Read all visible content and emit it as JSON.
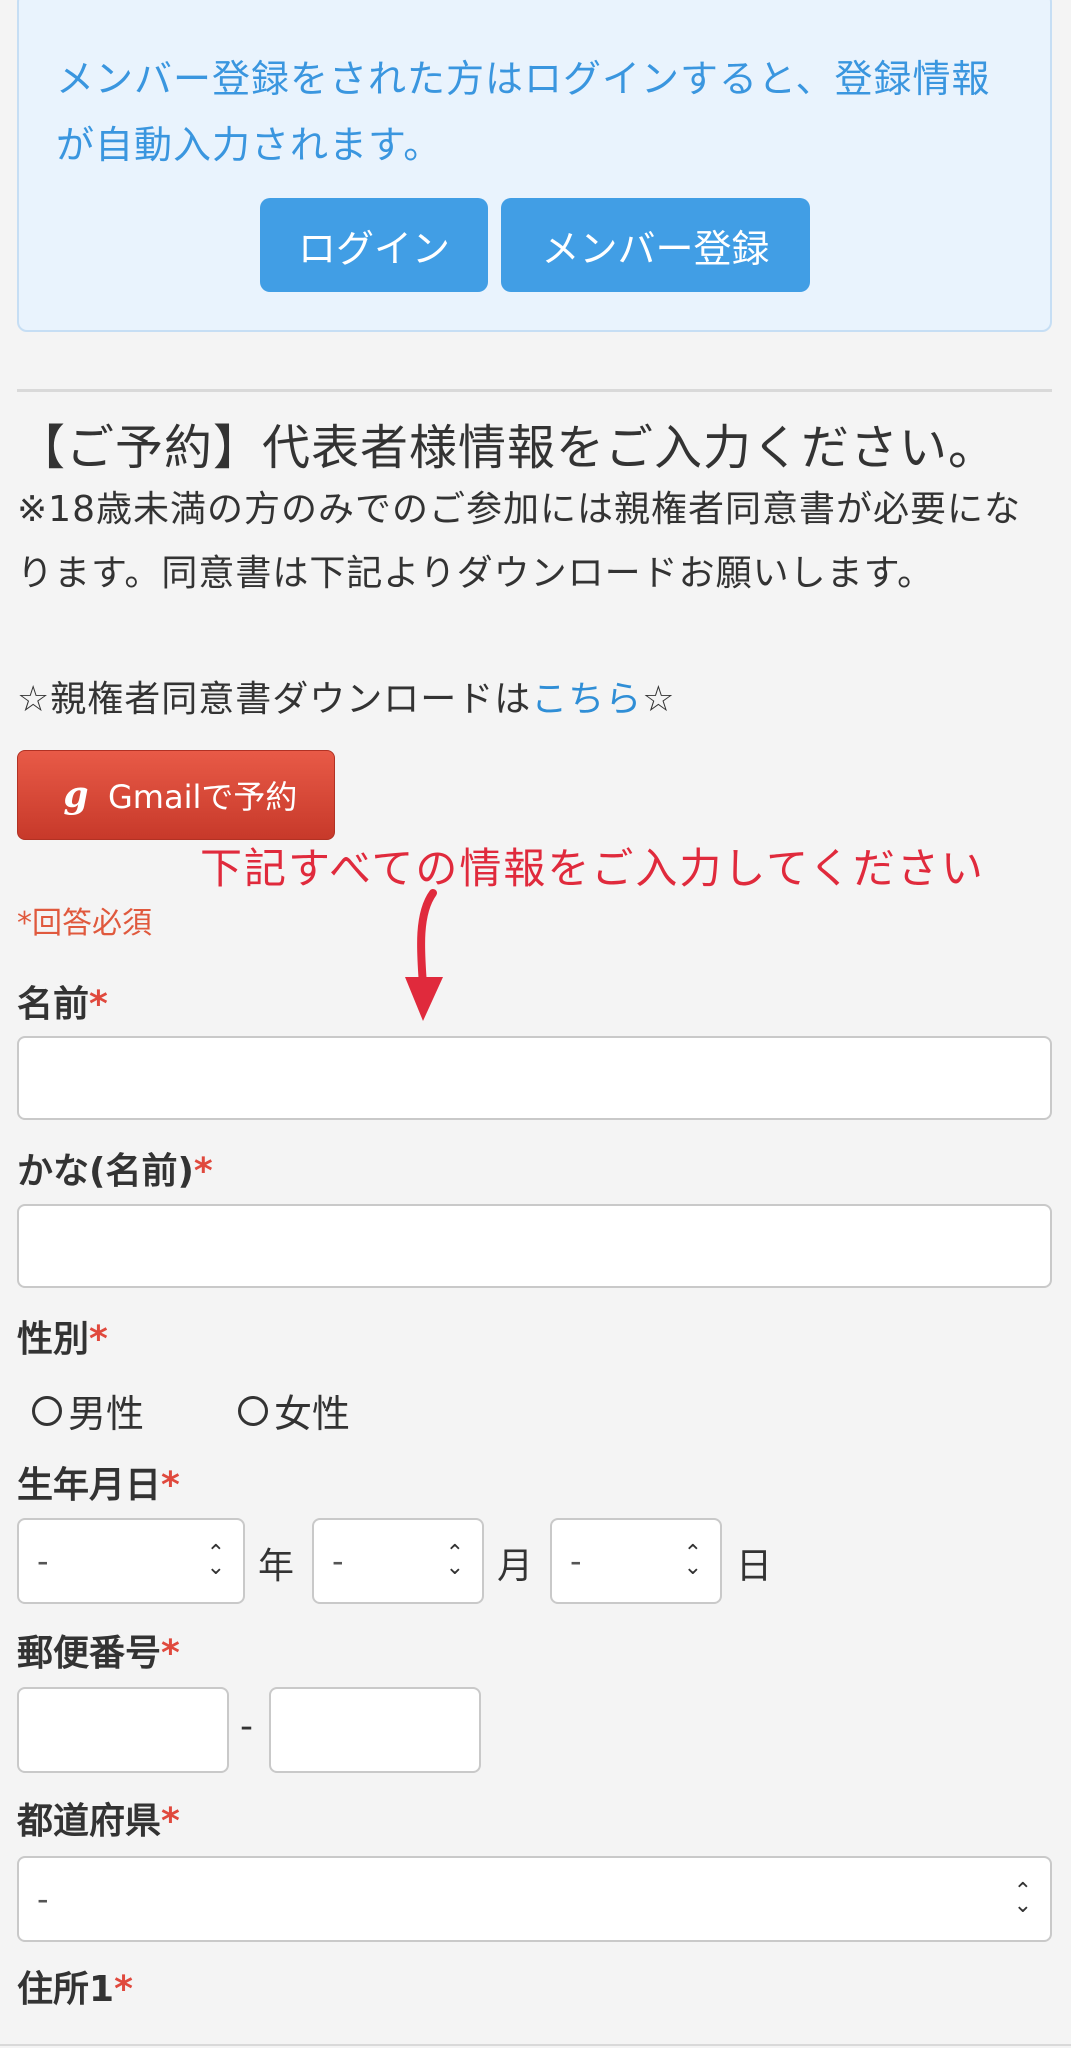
{
  "member_box": {
    "text": "メンバー登録をされた方はログインすると、登録情報が自動入力されます。",
    "login_label": "ログイン",
    "register_label": "メンバー登録"
  },
  "reservation": {
    "title": "【ご予約】代表者様情報をご入力ください。",
    "note": "※18歳未満の方のみでのご参加には親権者同意書が必要になります。同意書は下記よりダウンロードお願いします。",
    "download_prefix": "☆親権者同意書ダウンロードは",
    "download_link": "こちら",
    "download_suffix": "☆",
    "gmail_label": "Gmailで予約",
    "gmail_icon": "g"
  },
  "annotation": {
    "text": "下記すべての情報をご入力してください",
    "color": "#e02a3c"
  },
  "required_note": "*回答必須",
  "fields": {
    "name": "名前",
    "kana": "かな(名前)",
    "gender": "性別",
    "gender_male": "男性",
    "gender_female": "女性",
    "birthday": "生年月日",
    "year_unit": "年",
    "month_unit": "月",
    "day_unit": "日",
    "birth_year_value": "-",
    "birth_month_value": "-",
    "birth_day_value": "-",
    "postal": "郵便番号",
    "postal_sep": "-",
    "prefecture": "都道府県",
    "prefecture_value": "-",
    "address1": "住所1",
    "required_star": "*"
  },
  "colors": {
    "primary": "#419ee5",
    "gmail": "#d84535",
    "required": "#e0493d"
  }
}
